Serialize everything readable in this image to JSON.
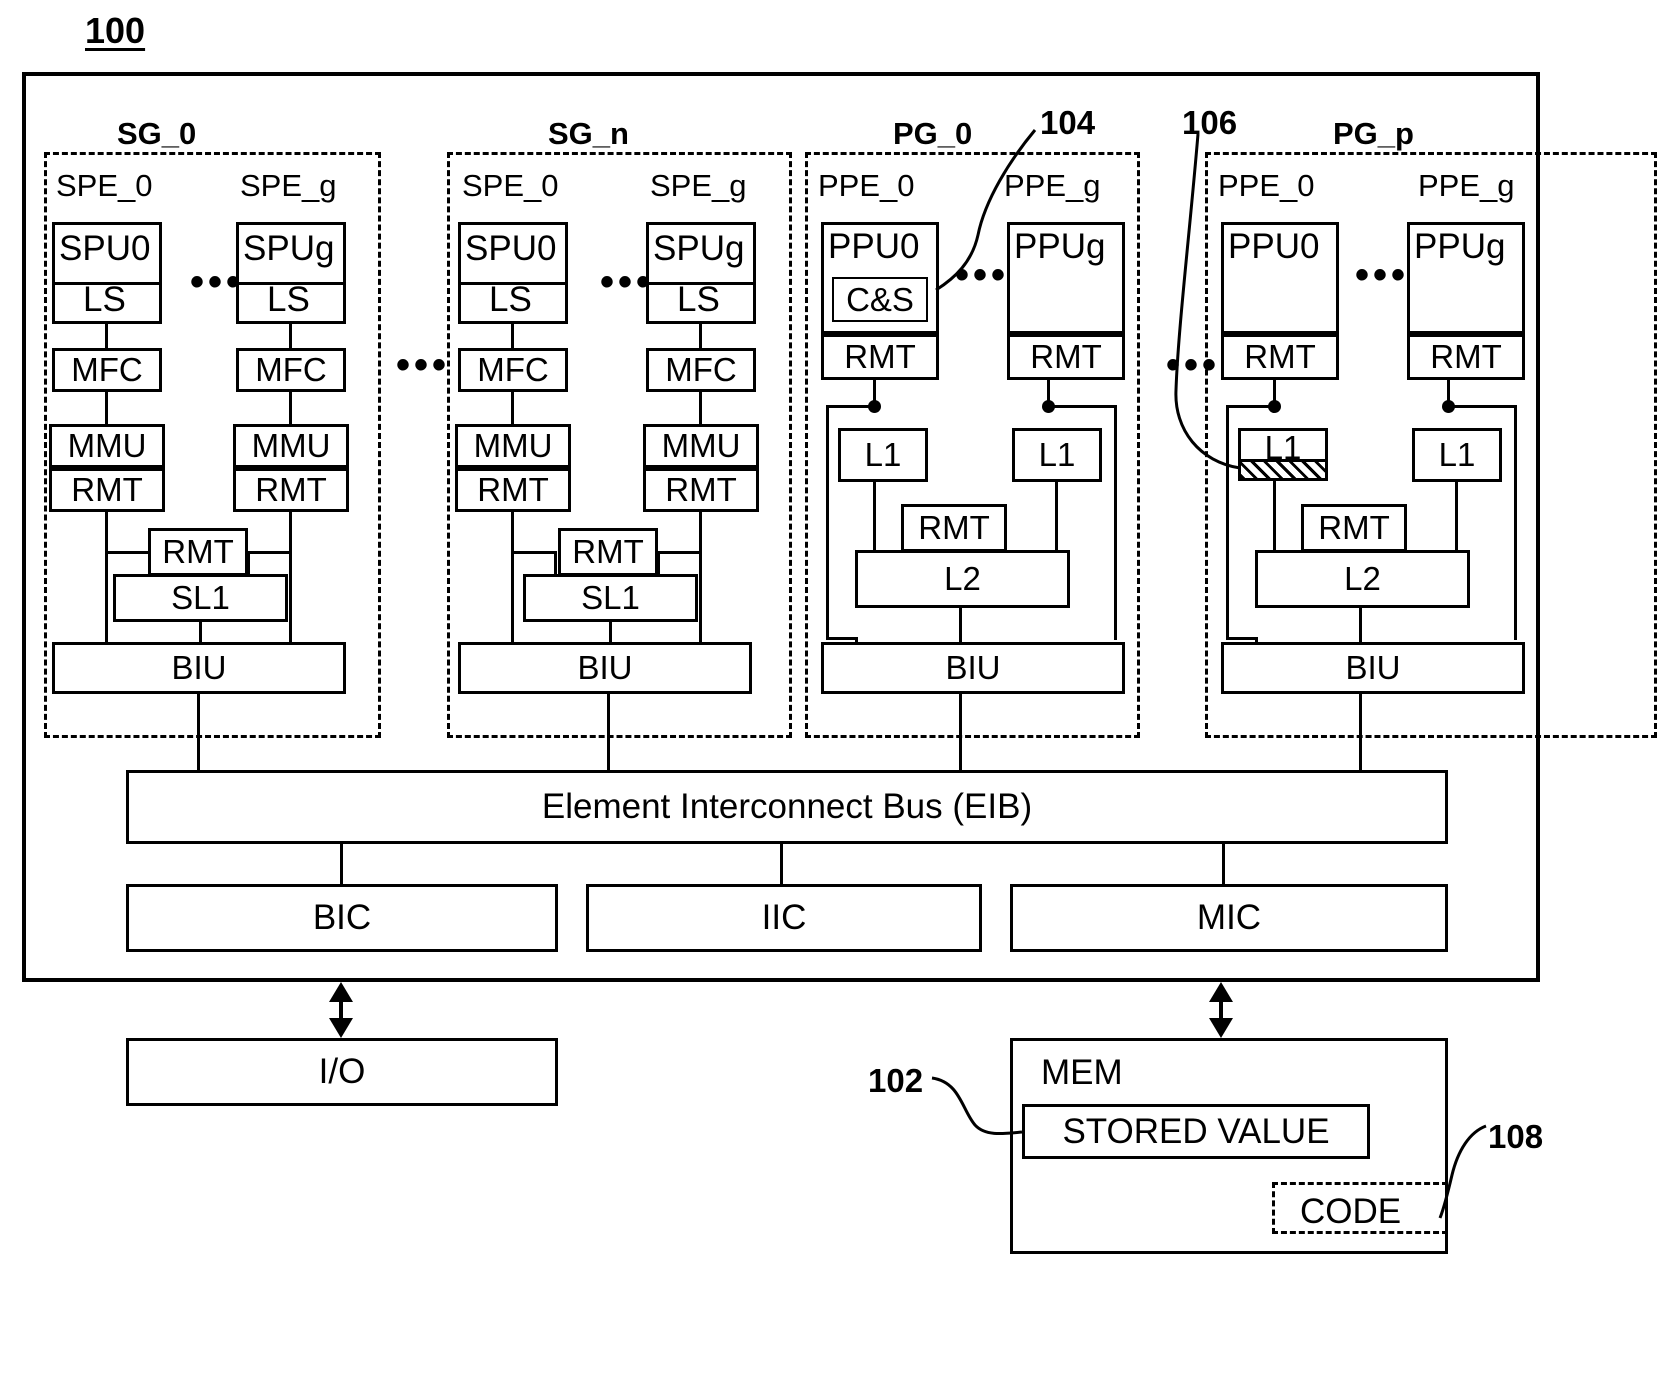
{
  "figure": {
    "ref_100": "100",
    "ref_102": "102",
    "ref_104": "104",
    "ref_106": "106",
    "ref_108": "108"
  },
  "groups": [
    {
      "id": "sg0",
      "title": "SG_0",
      "elements": [
        {
          "title": "SPE_0",
          "unit": "SPU0",
          "local": "LS",
          "mfc": "MFC",
          "mmu": "MMU",
          "rmt": "RMT"
        },
        {
          "title": "SPE_g",
          "unit": "SPUg",
          "local": "LS",
          "mfc": "MFC",
          "mmu": "MMU",
          "rmt": "RMT"
        }
      ],
      "shared_rmt": "RMT",
      "shared_cache": "SL1",
      "biu": "BIU",
      "ellipsis": "•••"
    },
    {
      "id": "sgn",
      "title": "SG_n",
      "elements": [
        {
          "title": "SPE_0",
          "unit": "SPU0",
          "local": "LS",
          "mfc": "MFC",
          "mmu": "MMU",
          "rmt": "RMT"
        },
        {
          "title": "SPE_g",
          "unit": "SPUg",
          "local": "LS",
          "mfc": "MFC",
          "mmu": "MMU",
          "rmt": "RMT"
        }
      ],
      "shared_rmt": "RMT",
      "shared_cache": "SL1",
      "biu": "BIU",
      "ellipsis": "•••"
    },
    {
      "id": "pg0",
      "title": "PG_0",
      "elements": [
        {
          "title": "PPE_0",
          "unit": "PPU0",
          "inner": "C&S",
          "rmt": "RMT",
          "l1": "L1"
        },
        {
          "title": "PPE_g",
          "unit": "PPUg",
          "inner": "",
          "rmt": "RMT",
          "l1": "L1"
        }
      ],
      "shared_rmt": "RMT",
      "shared_cache": "L2",
      "biu": "BIU",
      "ellipsis": "•••"
    },
    {
      "id": "pgp",
      "title": "PG_p",
      "elements": [
        {
          "title": "PPE_0",
          "unit": "PPU0",
          "inner": "",
          "rmt": "RMT",
          "l1": "L1"
        },
        {
          "title": "PPE_g",
          "unit": "PPUg",
          "inner": "",
          "rmt": "RMT",
          "l1": "L1"
        }
      ],
      "shared_rmt": "RMT",
      "shared_cache": "L2",
      "biu": "BIU",
      "ellipsis": "•••"
    }
  ],
  "group_ellipsis": "•••",
  "bus": {
    "label": "Element Interconnect Bus (EIB)"
  },
  "controllers": [
    {
      "label": "BIC"
    },
    {
      "label": "IIC"
    },
    {
      "label": "MIC"
    }
  ],
  "io": {
    "label": "I/O"
  },
  "memory": {
    "label": "MEM",
    "stored_value": "STORED VALUE",
    "code": "CODE"
  }
}
